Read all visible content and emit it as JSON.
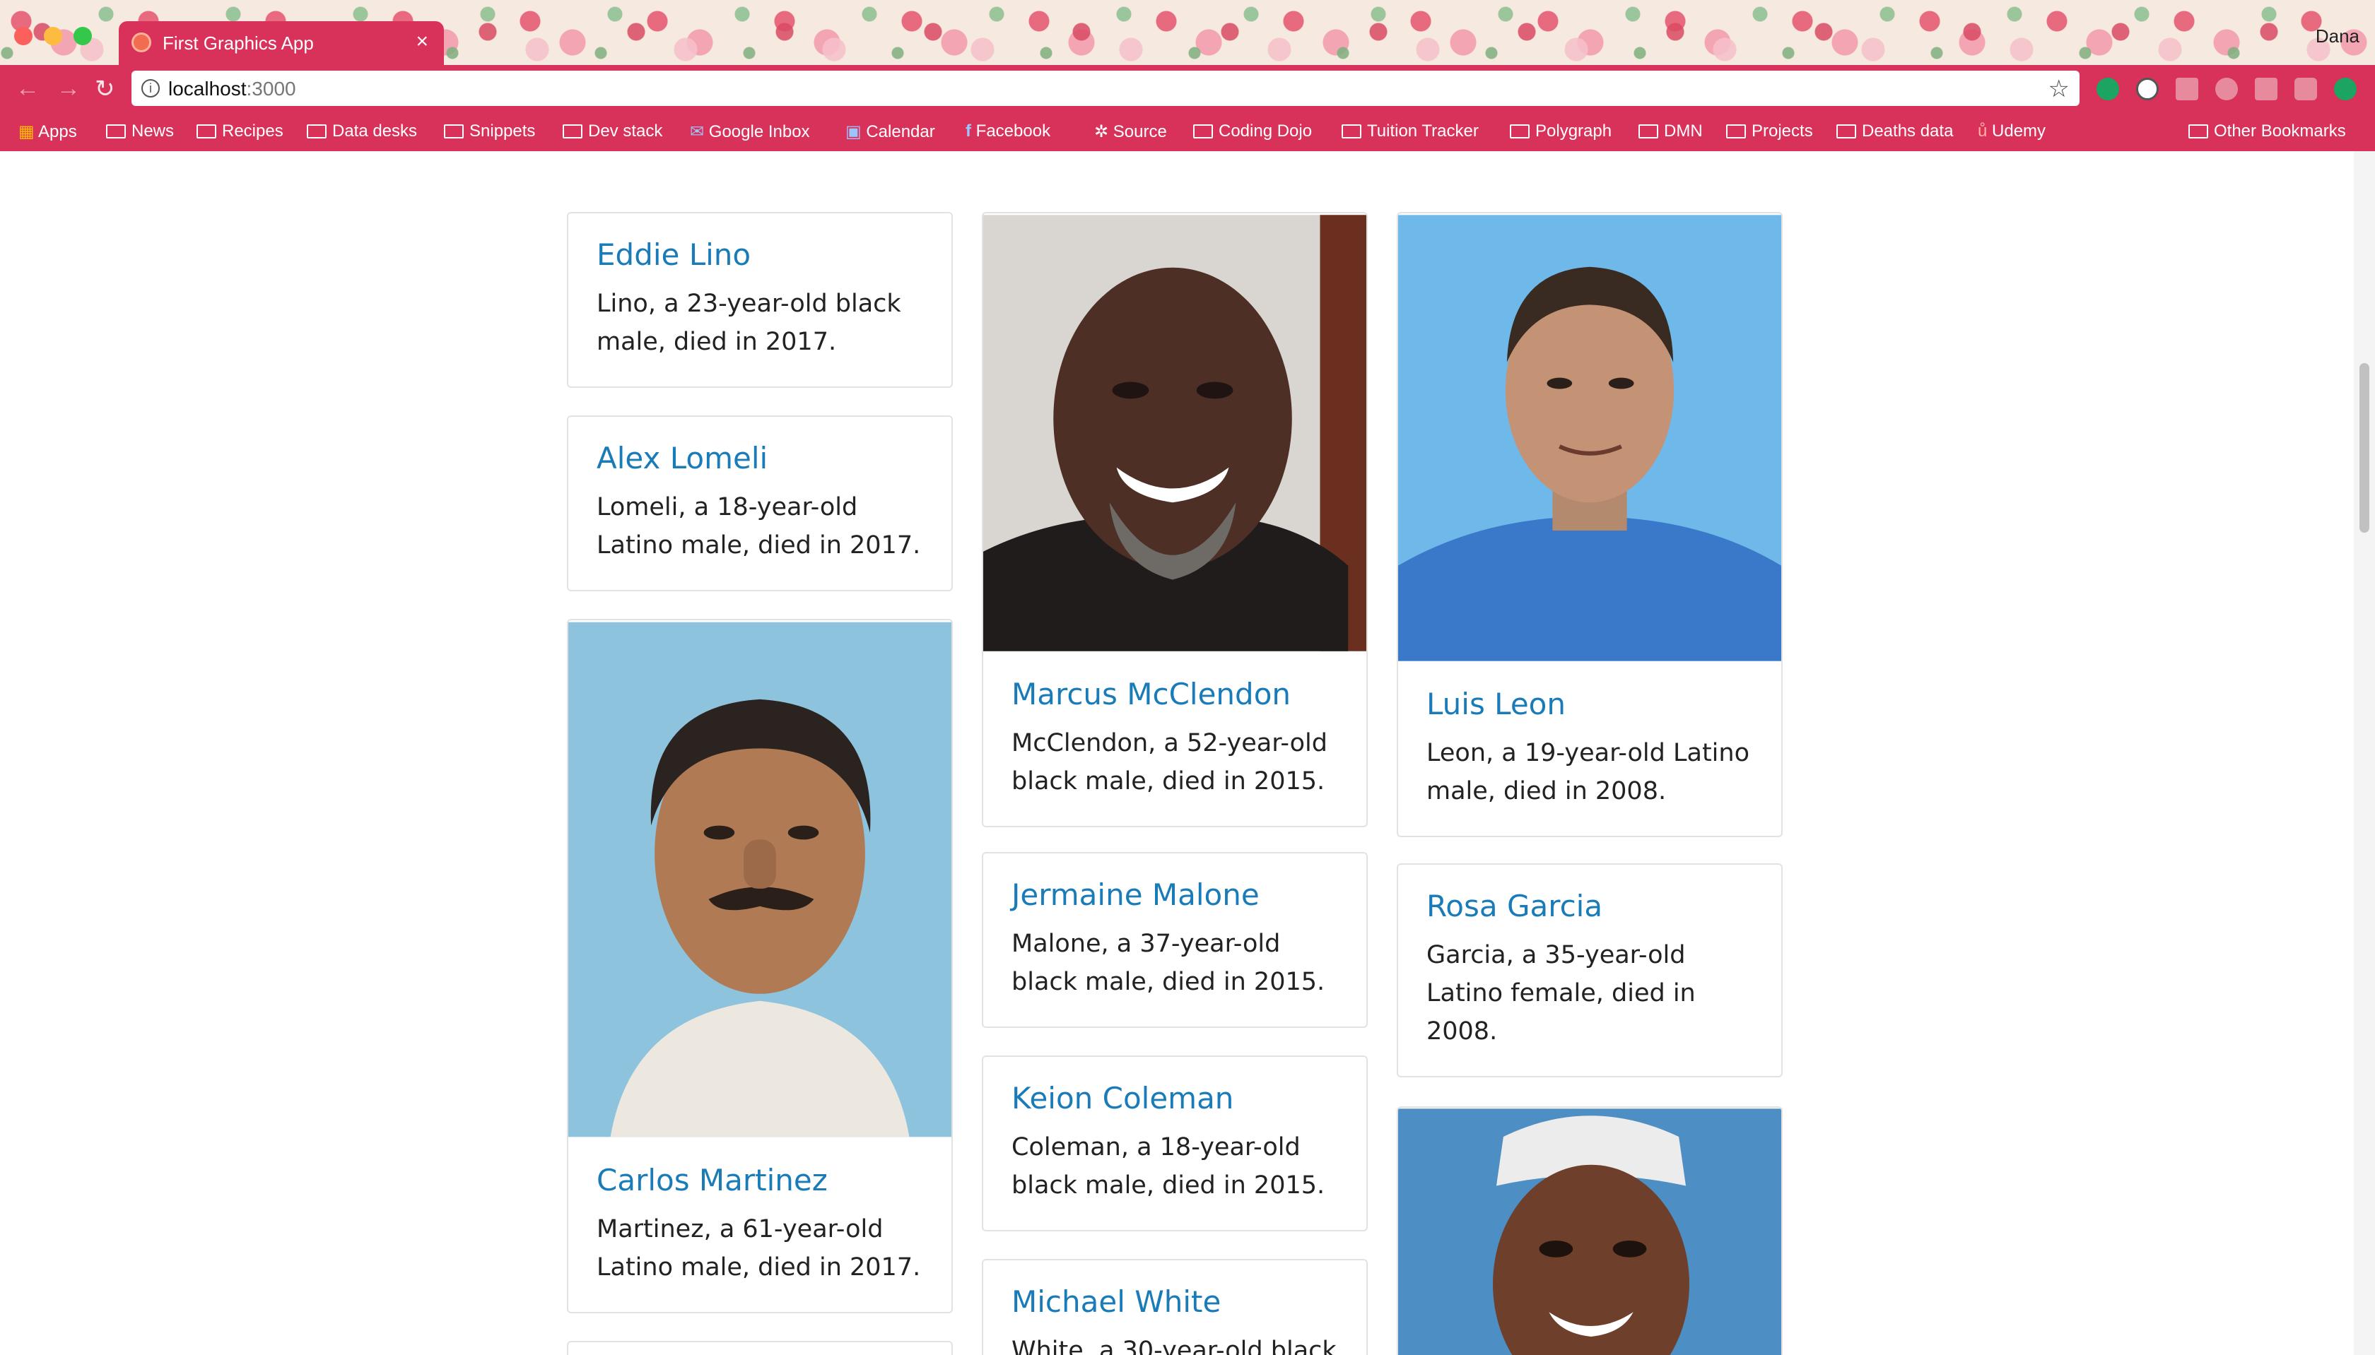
{
  "browser": {
    "tab_title": "First Graphics App",
    "tab_close": "×",
    "profile_name": "Dana",
    "url_host": "localhost",
    "url_port": ":3000",
    "info_icon": "i",
    "star_icon": "☆"
  },
  "bookmarks": [
    {
      "label": "Apps",
      "icon": "apps-grid-icon"
    },
    {
      "label": "News",
      "icon": "folder-icon"
    },
    {
      "label": "Recipes",
      "icon": "folder-icon"
    },
    {
      "label": "Data desks",
      "icon": "folder-icon"
    },
    {
      "label": "Snippets",
      "icon": "folder-icon"
    },
    {
      "label": "Dev stack",
      "icon": "folder-icon"
    },
    {
      "label": "Google Inbox",
      "icon": "inbox-icon"
    },
    {
      "label": "Calendar",
      "icon": "calendar-icon"
    },
    {
      "label": "Facebook",
      "icon": "facebook-icon"
    },
    {
      "label": "Source",
      "icon": "source-icon"
    },
    {
      "label": "Coding Dojo",
      "icon": "folder-icon"
    },
    {
      "label": "Tuition Tracker",
      "icon": "folder-icon"
    },
    {
      "label": "Polygraph",
      "icon": "folder-icon"
    },
    {
      "label": "DMN",
      "icon": "folder-icon"
    },
    {
      "label": "Projects",
      "icon": "folder-icon"
    },
    {
      "label": "Deaths data",
      "icon": "folder-icon"
    },
    {
      "label": "Udemy",
      "icon": "udemy-icon"
    },
    {
      "label": "Other Bookmarks",
      "icon": "folder-icon"
    }
  ],
  "cards": [
    {
      "name": "Eddie Lino",
      "desc": "Lino, a 23-year-old black male, died in 2017.",
      "photo": false
    },
    {
      "name": "Alex Lomeli",
      "desc": "Lomeli, a 18-year-old Latino male, died in 2017.",
      "photo": false
    },
    {
      "name": "Carlos Martinez",
      "desc": "Martinez, a 61-year-old Latino male, died in 2017.",
      "photo": true
    },
    {
      "name": "Marcus McClendon",
      "desc": "McClendon, a 52-year-old black male, died in 2015.",
      "photo": true
    },
    {
      "name": "Jermaine Malone",
      "desc": "Malone, a 37-year-old black male, died in 2015.",
      "photo": false
    },
    {
      "name": "Keion Coleman",
      "desc": "Coleman, a 18-year-old black male, died in 2015.",
      "photo": false
    },
    {
      "name": "Michael White",
      "desc": "White, a 30-year-old black",
      "photo": false
    },
    {
      "name": "Luis Leon",
      "desc": "Leon, a 19-year-old Latino male, died in 2008.",
      "photo": true
    },
    {
      "name": "Rosa Garcia",
      "desc": "Garcia, a 35-year-old Latino female, died in 2008.",
      "photo": false
    }
  ],
  "colors": {
    "accent": "#d9325a",
    "link": "#1a7bb9",
    "text": "#222222"
  }
}
